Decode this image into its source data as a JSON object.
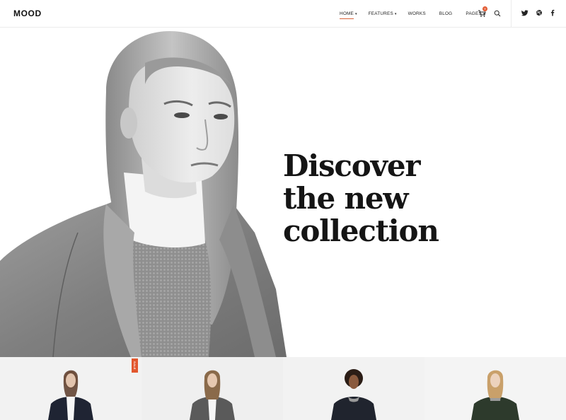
{
  "brand": {
    "logo": "MOOD",
    "accent": "#d9623a"
  },
  "nav": {
    "items": [
      {
        "label": "HOME",
        "has_dropdown": true,
        "active": true
      },
      {
        "label": "FEATURES",
        "has_dropdown": true,
        "active": false
      },
      {
        "label": "WORKS",
        "has_dropdown": false,
        "active": false
      },
      {
        "label": "BLOG",
        "has_dropdown": false,
        "active": false
      },
      {
        "label": "PAGES",
        "has_dropdown": true,
        "active": false
      }
    ],
    "cart_count": "0",
    "icons": [
      "cart-icon",
      "search-icon"
    ],
    "social_icons": [
      "twitter-icon",
      "dribbble-icon",
      "facebook-icon"
    ]
  },
  "hero": {
    "title_line1": "Discover",
    "title_line2": "the new",
    "title_line3": "collection"
  },
  "products": {
    "sale_label": "SALE",
    "items": [
      {
        "coat_color": "#1f2433"
      },
      {
        "coat_color": "#5a5a5a"
      },
      {
        "coat_color": "#20242e"
      },
      {
        "coat_color": "#2d3a2c"
      }
    ]
  }
}
